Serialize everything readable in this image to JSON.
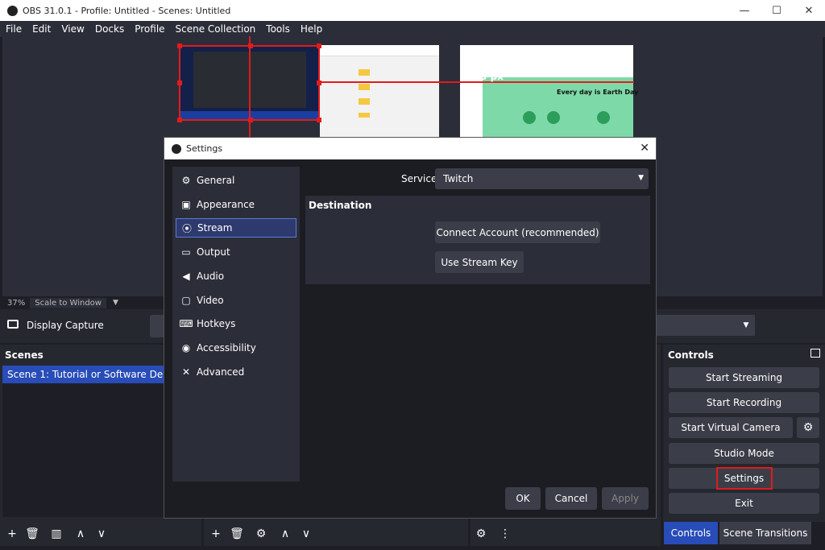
{
  "window": {
    "title": "OBS 31.0.1 - Profile: Untitled - Scenes: Untitled",
    "min": "—",
    "max": "☐",
    "close": "✕"
  },
  "menu": [
    "File",
    "Edit",
    "View",
    "Docks",
    "Profile",
    "Scene Collection",
    "Tools",
    "Help"
  ],
  "preview": {
    "size_label": "1183 px",
    "zoom": "37%",
    "scale_mode": "Scale to Window",
    "thumb_title": "Every day is Earth Day"
  },
  "source_bar": {
    "source_name": "Display Capture"
  },
  "scenes": {
    "title": "Scenes",
    "items": [
      "Scene 1: Tutorial or Software Demonstration"
    ]
  },
  "controls": {
    "title": "Controls",
    "buttons": [
      "Start Streaming",
      "Start Recording",
      "Start Virtual Camera",
      "Studio Mode",
      "Settings",
      "Exit"
    ],
    "tabs": [
      "Controls",
      "Scene Transitions"
    ]
  },
  "settings": {
    "title": "Settings",
    "close": "✕",
    "sidebar": [
      "General",
      "Appearance",
      "Stream",
      "Output",
      "Audio",
      "Video",
      "Hotkeys",
      "Accessibility",
      "Advanced"
    ],
    "active": "Stream",
    "service_label": "Service",
    "service_value": "Twitch",
    "destination_label": "Destination",
    "connect_button": "Connect Account (recommended)",
    "stream_key_button": "Use Stream Key",
    "ok": "OK",
    "cancel": "Cancel",
    "apply": "Apply"
  },
  "colors": {
    "accent": "#284cb8",
    "highlight": "#e21b1b",
    "bg": "#1e1f26",
    "panel": "#2b2e38",
    "button": "#3b3e48"
  }
}
